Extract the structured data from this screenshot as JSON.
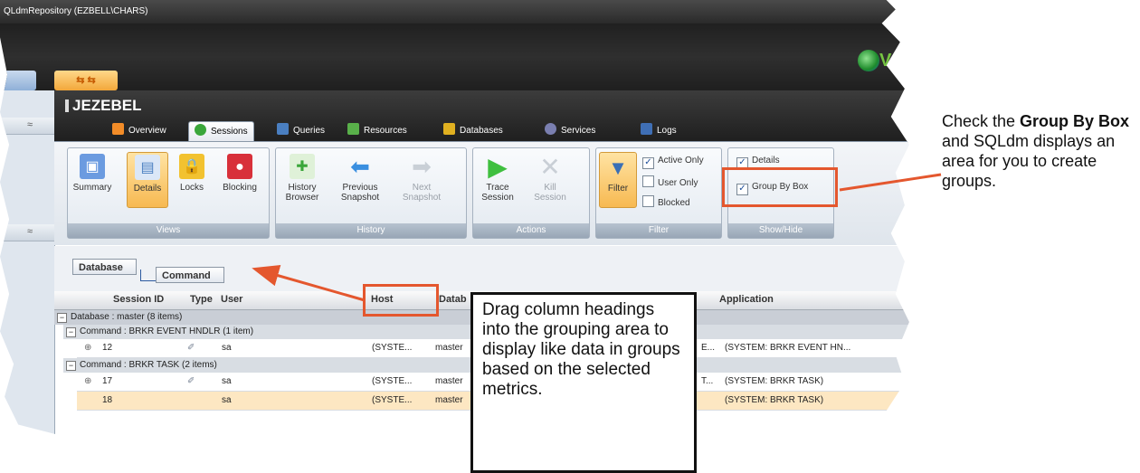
{
  "window": {
    "title": "QLdmRepository (EZBELL\\CHARS)"
  },
  "server": {
    "name": "JEZEBEL"
  },
  "tabs": [
    {
      "label": "Overview",
      "color": "#f28c28"
    },
    {
      "label": "Sessions",
      "color": "#3aa63a"
    },
    {
      "label": "Queries",
      "color": "#4a7fc1"
    },
    {
      "label": "Resources",
      "color": "#59b04a"
    },
    {
      "label": "Databases",
      "color": "#e0b020"
    },
    {
      "label": "Services",
      "color": "#7a7fb0"
    },
    {
      "label": "Logs",
      "color": "#3f6fb5"
    }
  ],
  "ribbon": {
    "views": {
      "caption": "Views",
      "summary": "Summary",
      "details": "Details",
      "locks": "Locks",
      "blocking": "Blocking"
    },
    "history": {
      "caption": "History",
      "browser_1": "History",
      "browser_2": "Browser",
      "prev_1": "Previous",
      "prev_2": "Snapshot",
      "next_1": "Next",
      "next_2": "Snapshot"
    },
    "actions": {
      "caption": "Actions",
      "trace_1": "Trace",
      "trace_2": "Session",
      "kill_1": "Kill",
      "kill_2": "Session"
    },
    "filter": {
      "caption": "Filter",
      "filter": "Filter",
      "active_only": "Active Only",
      "user_only": "User Only",
      "blocked": "Blocked"
    },
    "showhide": {
      "caption": "Show/Hide",
      "details": "Details",
      "group_by_box": "Group By Box"
    }
  },
  "grouping": {
    "pill1": "Database",
    "pill2": "Command"
  },
  "columns": {
    "session_id": "Session ID",
    "type": "Type",
    "user": "User",
    "host": "Host",
    "database": "Datab",
    "application": "Application"
  },
  "groups": {
    "db_master": "Database : master (8 items)",
    "cmd_event": "Command : BRKR EVENT HNDLR (1 item)",
    "cmd_task": "Command : BRKR TASK (2 items)"
  },
  "rows": [
    {
      "id": "12",
      "user": "sa",
      "host": "(SYSTE...",
      "db": "master",
      "extra": "E...",
      "app": "(SYSTEM: BRKR EVENT HN..."
    },
    {
      "id": "17",
      "user": "sa",
      "host": "(SYSTE...",
      "db": "master",
      "extra": "T...",
      "app": "(SYSTEM: BRKR TASK)"
    },
    {
      "id": "18",
      "user": "sa",
      "host": "(SYSTE...",
      "db": "master",
      "extra": "",
      "app": "(SYSTEM: BRKR TASK)"
    }
  ],
  "callout_drag": "Drag column headings into the grouping area to display like data in groups based on the selected metrics.",
  "note": {
    "p1": "Check the ",
    "b1": "Group By Box",
    "p2": " and SQLdm displays an area for you to create groups."
  },
  "colors": {
    "accent_red": "#e4572e",
    "highlight": "#f7b951"
  }
}
